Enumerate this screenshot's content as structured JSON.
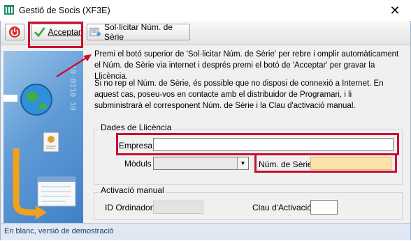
{
  "window": {
    "title": "Gestió de Socis (XF3E)",
    "close_glyph": "✕"
  },
  "toolbar": {
    "accept_label": "Acceptar",
    "request_label": "Sol·licitar Núm. de Sèrie"
  },
  "side_panel": {
    "binary_text": "10 0110 10"
  },
  "info": {
    "paragraph1": "Premi el botó superior de 'Sol·licitar Núm. de Sèrie' per rebre i omplir automàticament el Núm. de Sèrie via internet i després premi el botó de 'Acceptar' per gravar la Llicència.",
    "paragraph2": "Si no rep el Núm. de Sèrie, és possible que no disposi de connexió a Internet. En aquest cas, poseu-vos en contacte amb el distribuidor de Programari, i li subministrarà el corresponent Núm. de Sèrie i la Clau d'activació manual."
  },
  "license": {
    "group_label": "Dades de Llicència",
    "company_label": "Empresa",
    "company_value": "",
    "modules_label": "Mòduls",
    "modules_value": "",
    "serial_label": "Núm. de Sèrie",
    "serial_value": ""
  },
  "activation": {
    "group_label": "Activació manual",
    "computer_id_label": "ID Ordinador",
    "computer_id_value": "",
    "activation_key_label": "Clau d'Activació",
    "activation_key_value": ""
  },
  "status_bar": {
    "text": "En blanc, versió de demostració"
  },
  "colors": {
    "highlight": "#c8102e",
    "serial_field": "#fde3a7"
  }
}
